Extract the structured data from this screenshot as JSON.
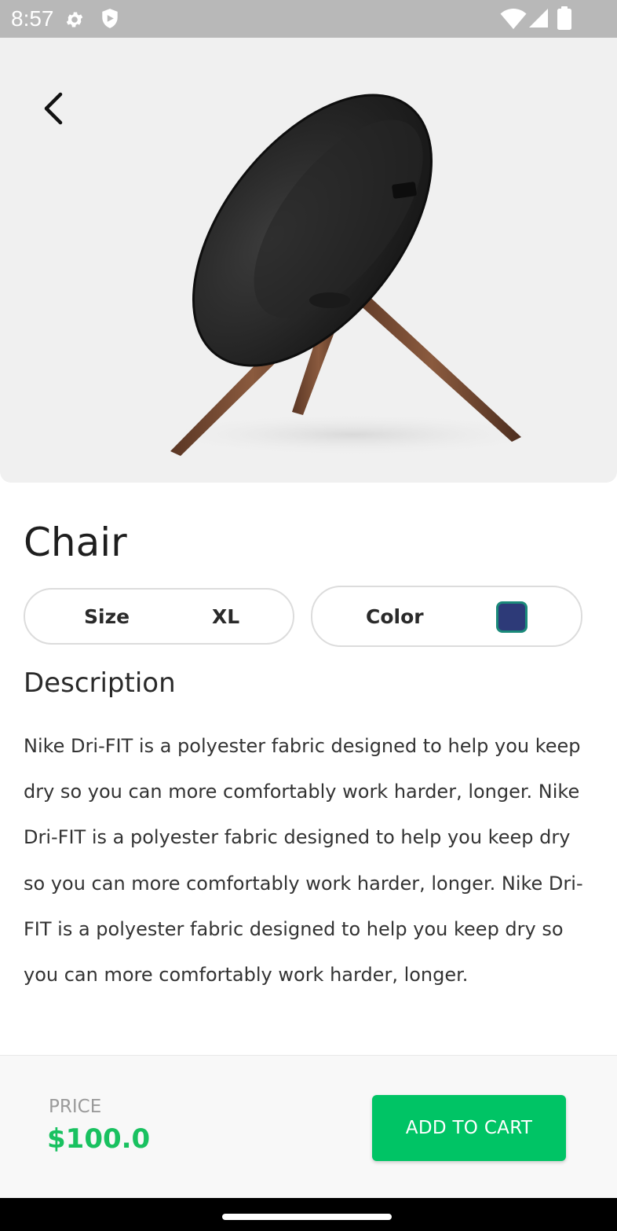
{
  "status_bar": {
    "time": "8:57",
    "icons": [
      "gear-icon",
      "shield-icon",
      "wifi-icon",
      "signal-icon",
      "battery-icon"
    ]
  },
  "navigation": {
    "back_icon": "chevron-left-icon"
  },
  "product": {
    "title": "Chair",
    "image": "speaker-chair-image"
  },
  "options": {
    "size_label": "Size",
    "size_value": "XL",
    "color_label": "Color",
    "color_value": "#2d3a78"
  },
  "description": {
    "heading": "Description",
    "text": "Nike Dri-FIT is a polyester fabric designed to help you keep dry so you can more comfortably work harder, longer. Nike Dri-FIT is a polyester fabric designed to help you keep dry so you can more comfortably work harder, longer. Nike Dri-FIT is a polyester fabric designed to help you keep dry so you can more comfortably work harder, longer."
  },
  "footer": {
    "price_label": "PRICE",
    "price": "$100.0",
    "add_to_cart_label": "ADD TO CART"
  },
  "colors": {
    "accent": "#00c465",
    "price": "#19c160",
    "swatch_border": "#1b8a7a"
  }
}
